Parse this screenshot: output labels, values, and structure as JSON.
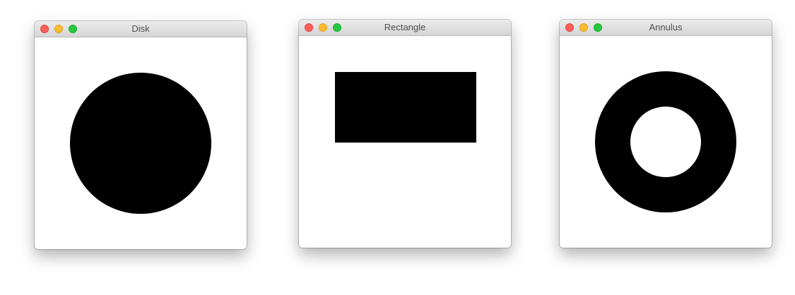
{
  "traffic_light_colors": {
    "close": "#fe5f57",
    "minimize": "#febc2e",
    "zoom": "#28c840"
  },
  "shape_color": "#000000",
  "windows": [
    {
      "title": "Disk",
      "shape": "disk"
    },
    {
      "title": "Rectangle",
      "shape": "rectangle"
    },
    {
      "title": "Annulus",
      "shape": "annulus"
    }
  ]
}
